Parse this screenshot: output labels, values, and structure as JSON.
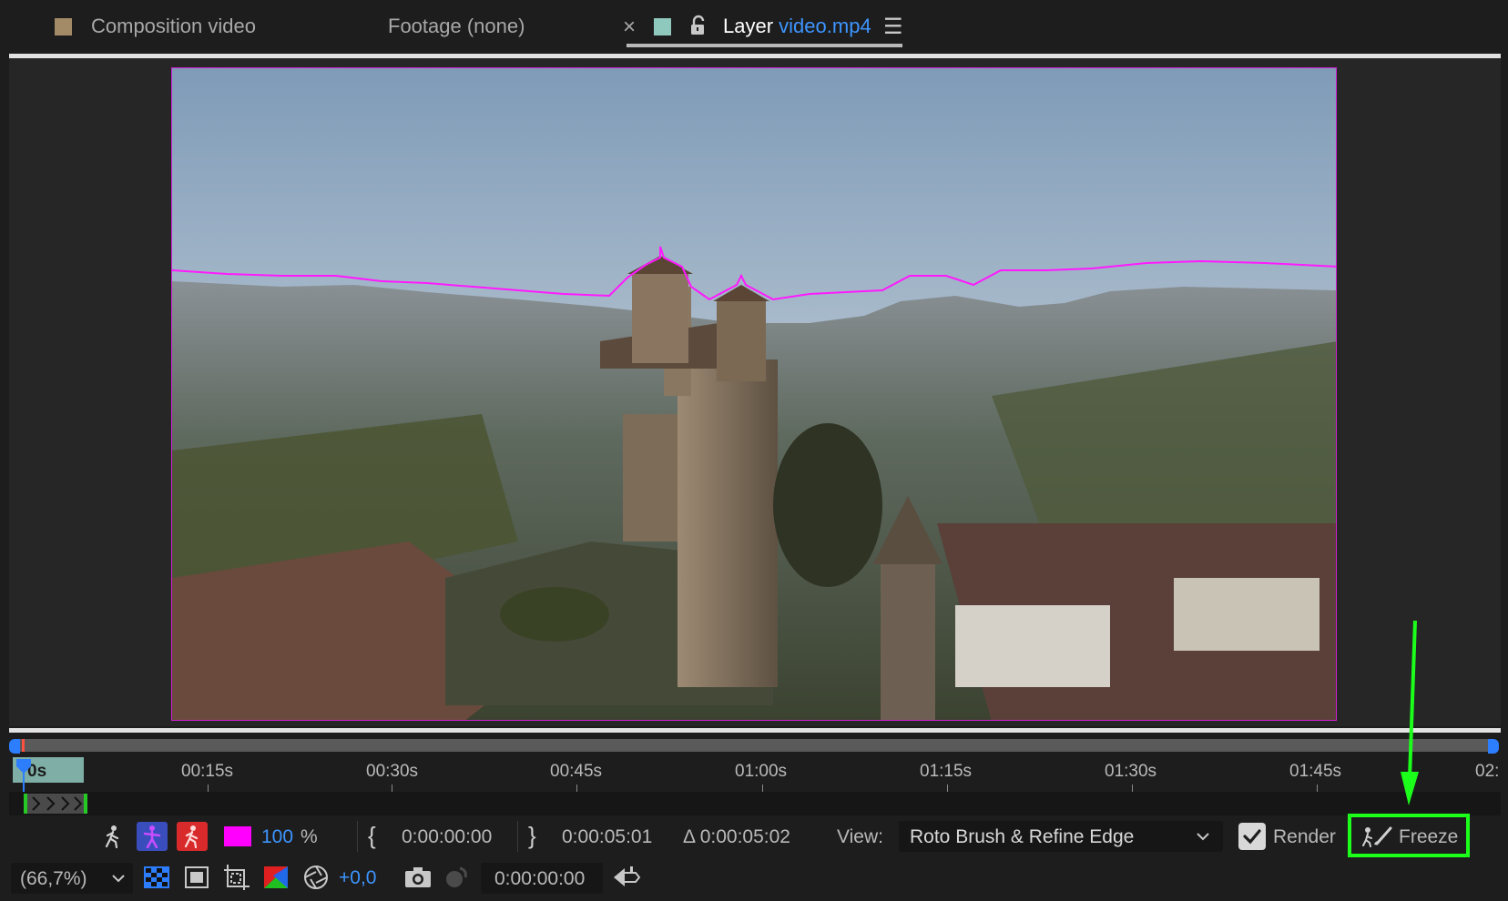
{
  "tabs": [
    {
      "label": "Composition video",
      "swatch": "#a48b67"
    },
    {
      "label": "Footage (none)"
    },
    {
      "prefix": "Layer",
      "name": "video.mp4",
      "swatch": "#8fc8bd",
      "active": true
    }
  ],
  "tab_close": "×",
  "tab_menu": "☰",
  "timeline": {
    "current": "0s",
    "labels": [
      "00:15s",
      "00:30s",
      "00:45s",
      "01:00s",
      "01:15s",
      "01:30s",
      "01:45s",
      "02:"
    ]
  },
  "controls": {
    "opacity_value": "100",
    "opacity_unit": "%",
    "in_point": "0:00:00:00",
    "out_point": "0:00:05:01",
    "duration": "Δ 0:00:05:02",
    "view_label": "View:",
    "view_value": "Roto Brush & Refine Edge",
    "render_label": "Render",
    "freeze_label": "Freeze",
    "mask_color": "#ff00ff"
  },
  "bottom": {
    "zoom": "(66,7%)",
    "exposure": "+0,0",
    "timecode": "0:00:00:00"
  },
  "annotation_color": "#1bff1b"
}
